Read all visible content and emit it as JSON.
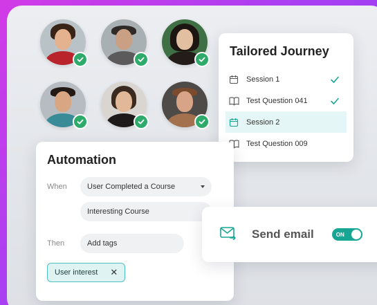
{
  "journey": {
    "title": "Tailored Journey",
    "items": [
      {
        "label": "Session 1",
        "icon": "calendar-icon",
        "done": true,
        "active": false
      },
      {
        "label": "Test Question 041",
        "icon": "book-icon",
        "done": true,
        "active": false
      },
      {
        "label": "Session 2",
        "icon": "calendar-icon",
        "done": false,
        "active": true
      },
      {
        "label": "Test Question 009",
        "icon": "book-icon",
        "done": false,
        "active": false
      }
    ]
  },
  "automation": {
    "title": "Automation",
    "when_label": "When",
    "trigger_value": "User Completed a Course",
    "course_value": "Interesting Course",
    "then_label": "Then",
    "action_value": "Add tags",
    "tag_label": "User interest",
    "tag_remove": "✕"
  },
  "email": {
    "label": "Send email",
    "toggle_label": "ON",
    "toggle_on": true
  },
  "colors": {
    "accent": "#17a594",
    "check": "#2eaa6a",
    "tag_border": "#4cc1c0",
    "active_row": "#e4f6f5"
  }
}
